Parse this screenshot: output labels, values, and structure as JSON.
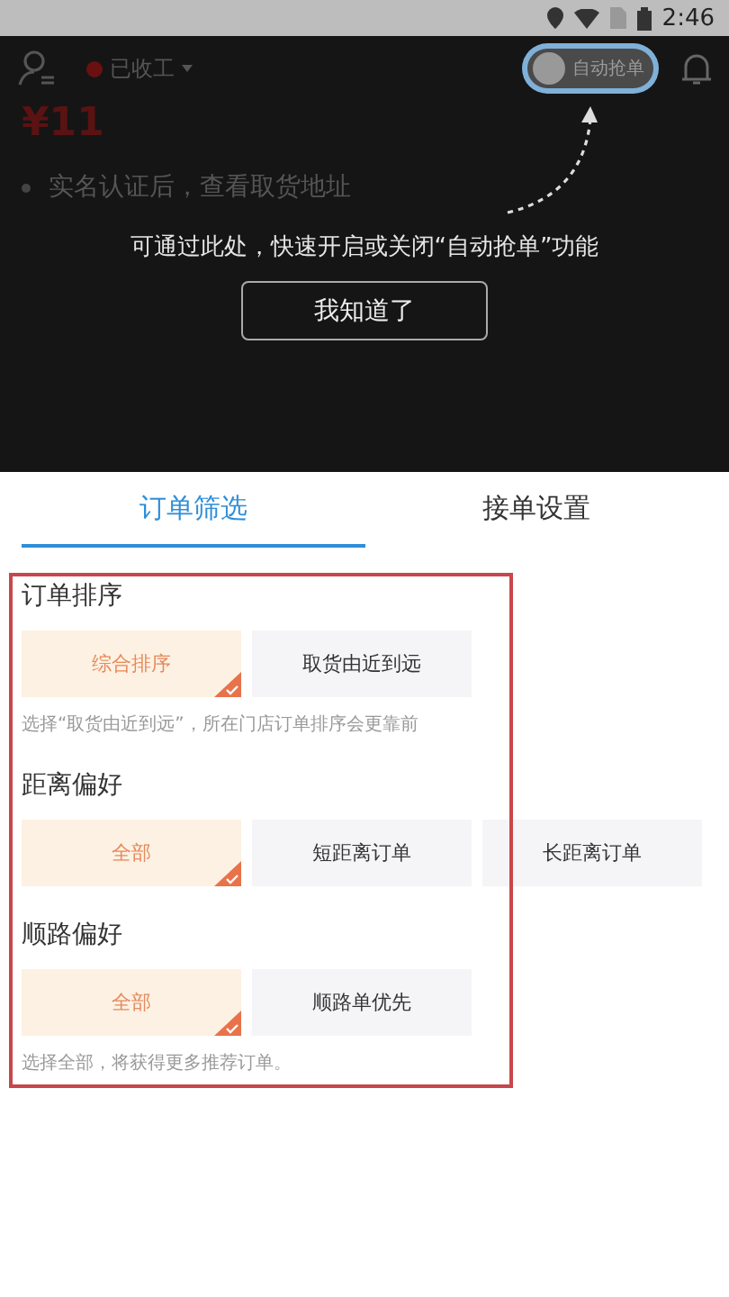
{
  "status_bar": {
    "time": "2:46"
  },
  "header": {
    "status": "已收工",
    "auto_grab": {
      "label": "自动抢单",
      "on": false
    }
  },
  "order": {
    "price": "¥11",
    "lines": [
      "实名认证后，查看取货地址"
    ]
  },
  "coach_mark": {
    "message": "可通过此处，快速开启或关闭“自动抢单”功能",
    "button": "我知道了"
  },
  "tabs": [
    {
      "label": "订单筛选",
      "selected": true
    },
    {
      "label": "接单设置",
      "selected": false
    }
  ],
  "sections": [
    {
      "title": "订单排序",
      "options": [
        {
          "label": "综合排序",
          "selected": true
        },
        {
          "label": "取货由近到远",
          "selected": false
        }
      ],
      "hint": "选择“取货由近到远”，所在门店订单排序会更靠前"
    },
    {
      "title": "距离偏好",
      "options": [
        {
          "label": "全部",
          "selected": true
        },
        {
          "label": "短距离订单",
          "selected": false
        },
        {
          "label": "长距离订单",
          "selected": false
        }
      ]
    },
    {
      "title": "顺路偏好",
      "options": [
        {
          "label": "全部",
          "selected": true
        },
        {
          "label": "顺路单优先",
          "selected": false
        }
      ],
      "hint": "选择全部，将获得更多推荐订单。"
    }
  ]
}
